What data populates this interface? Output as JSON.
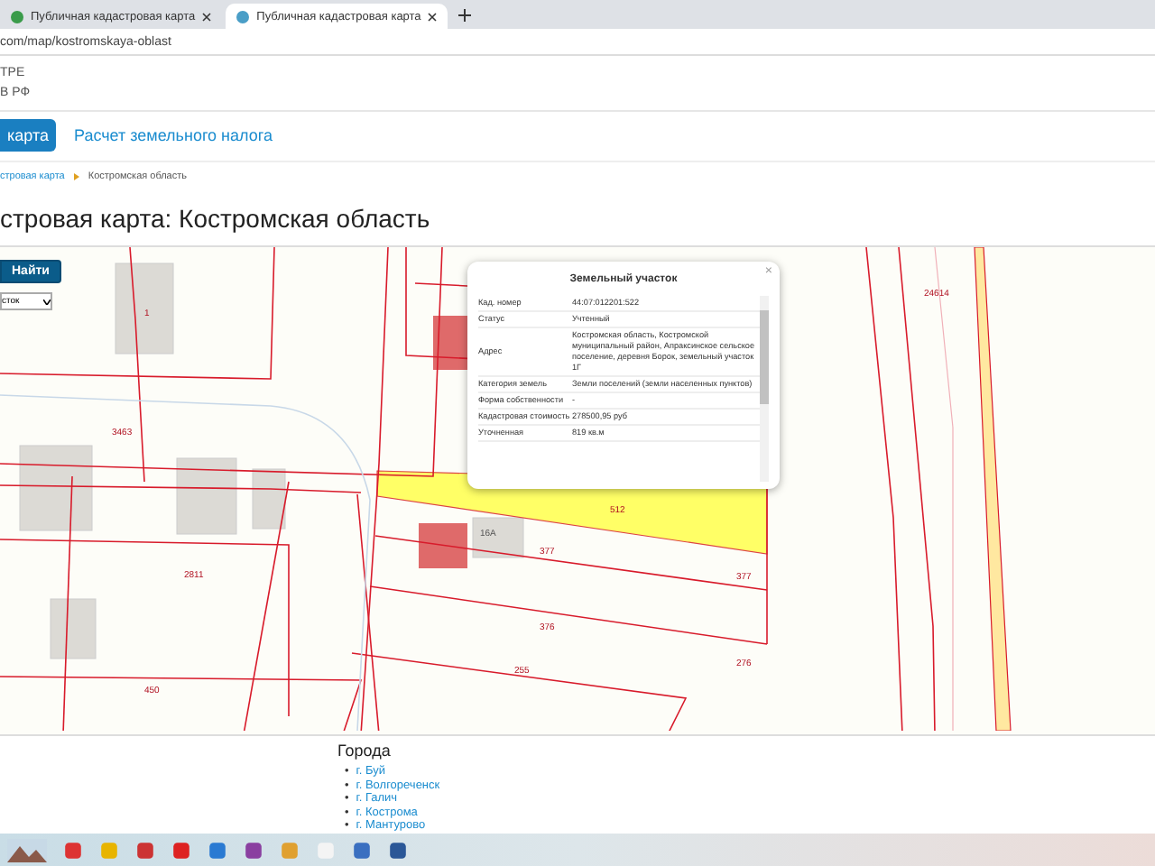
{
  "browser": {
    "tabs": [
      {
        "title": "Публичная кадастровая карта",
        "selected": false
      },
      {
        "title": "Публичная кадастровая карта",
        "selected": true
      }
    ],
    "address": "com/map/kostromskaya-oblast"
  },
  "header": {
    "lines": [
      "ТРЕ",
      "В РФ"
    ]
  },
  "nav": [
    {
      "label": "карта",
      "selected": true
    },
    {
      "label": "Расчет земельного налога",
      "selected": false
    }
  ],
  "breadcrumbs": [
    "стровая карта",
    "Костромская область"
  ],
  "title": "стровая карта: Костромская область",
  "map": {
    "search_button": "Найти",
    "type_select": "сток",
    "parcel_labels": [
      "1",
      "3463",
      "2811",
      "450",
      "16А",
      "512",
      "377",
      "376",
      "255",
      "24614",
      "377",
      "276"
    ],
    "popup": {
      "title": "Земельный участок",
      "close": "×",
      "rows": [
        {
          "key": "Кад. номер",
          "value": "44:07:012201:522"
        },
        {
          "key": "Статус",
          "value": "Учтенный"
        },
        {
          "key": "Адрес",
          "value": "Костромская область, Костромской муниципальный район, Апраксинское сельское поселение, деревня Борок, земельный участок 1Г"
        },
        {
          "key": "Категория земель",
          "value": "Земли поселений (земли населенных пунктов)"
        },
        {
          "key": "Форма собственности",
          "value": "-"
        },
        {
          "key": "Кадастровая стоимость",
          "value": "278500,95 руб"
        },
        {
          "key": "Уточненная",
          "value": "819 кв.м"
        }
      ]
    }
  },
  "footer": {
    "heading": "Города",
    "bullet": "•",
    "cities": [
      "г. Буй",
      "г. Волгореченск",
      "г. Галич",
      "г. Кострома",
      "г. Мантурово"
    ]
  }
}
